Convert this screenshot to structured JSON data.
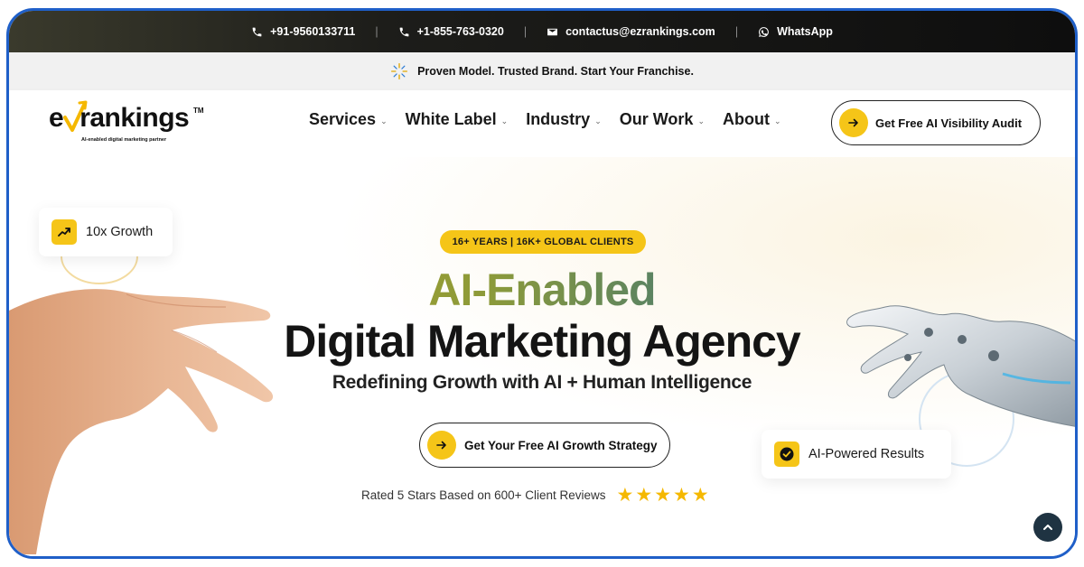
{
  "topbar": {
    "phone1": "+91-9560133711",
    "phone2": "+1-855-763-0320",
    "email": "contactus@ezrankings.com",
    "whatsapp": "WhatsApp",
    "separator": "|"
  },
  "announcement": {
    "text": "Proven Model. Trusted Brand. Start Your Franchise."
  },
  "logo": {
    "brand": "rankings",
    "brand_prefix": "e",
    "tm": "TM",
    "tagline": "AI-enabled digital marketing partner"
  },
  "nav": {
    "items": [
      {
        "label": "Services"
      },
      {
        "label": "White Label"
      },
      {
        "label": "Industry"
      },
      {
        "label": "Our Work"
      },
      {
        "label": "About"
      }
    ],
    "chevron": "⌄",
    "audit_button": "Get Free AI Visibility Audit"
  },
  "hero": {
    "pill": "16+ YEARS | 16K+ GLOBAL CLIENTS",
    "headline_ai": "AI-Enabled",
    "headline_main": "Digital Marketing Agency",
    "subheadline": "Redefining Growth with AI + Human Intelligence",
    "cta": "Get Your Free AI Growth Strategy",
    "rating_text": "Rated 5 Stars Based on 600+ Client Reviews",
    "stars": 5,
    "growth_badge": "10x Growth",
    "results_badge": "AI-Powered Results"
  },
  "colors": {
    "accent": "#f5c518",
    "frame": "#1f5fc8",
    "dark": "#141414"
  },
  "icons": [
    "phone-icon",
    "mail-icon",
    "whatsapp-icon",
    "spark-icon",
    "arrow-right-icon",
    "trend-up-icon",
    "check-badge-icon",
    "star-icon",
    "chevron-up-icon"
  ]
}
